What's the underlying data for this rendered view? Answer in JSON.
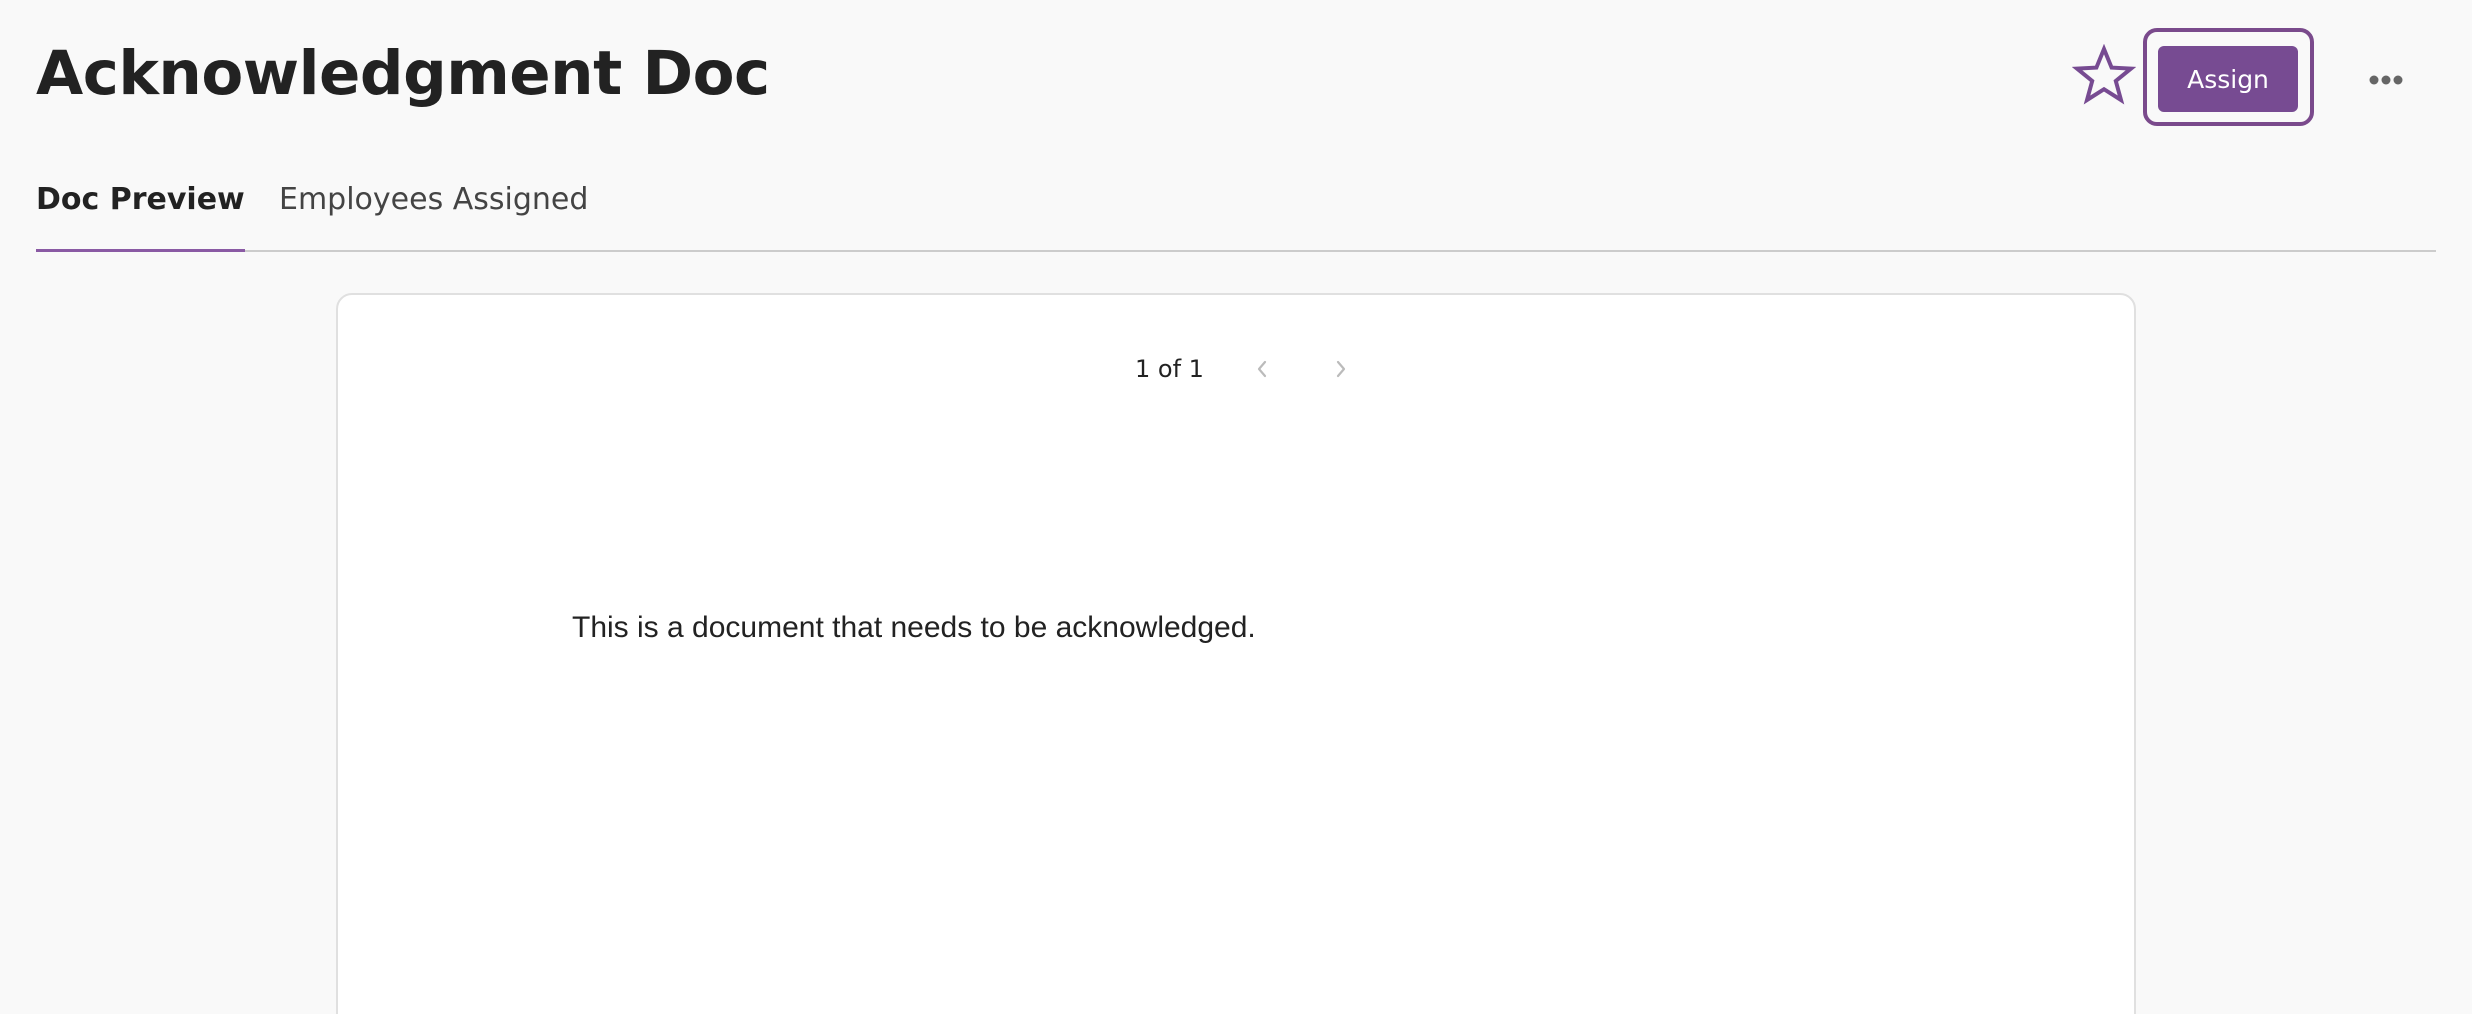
{
  "header": {
    "title": "Acknowledgment Doc",
    "assign_label": "Assign",
    "favorite_icon": "star-outline-icon",
    "more_icon": "more-horizontal-icon"
  },
  "tabs": [
    {
      "label": "Doc Preview",
      "active": true
    },
    {
      "label": "Employees Assigned",
      "active": false
    }
  ],
  "document": {
    "page_indicator": "1 of 1",
    "body_text": "This is a document that needs to be acknowledged."
  },
  "colors": {
    "accent": "#774b92",
    "page_background": "#f9f9f9",
    "card_background": "#ffffff"
  }
}
